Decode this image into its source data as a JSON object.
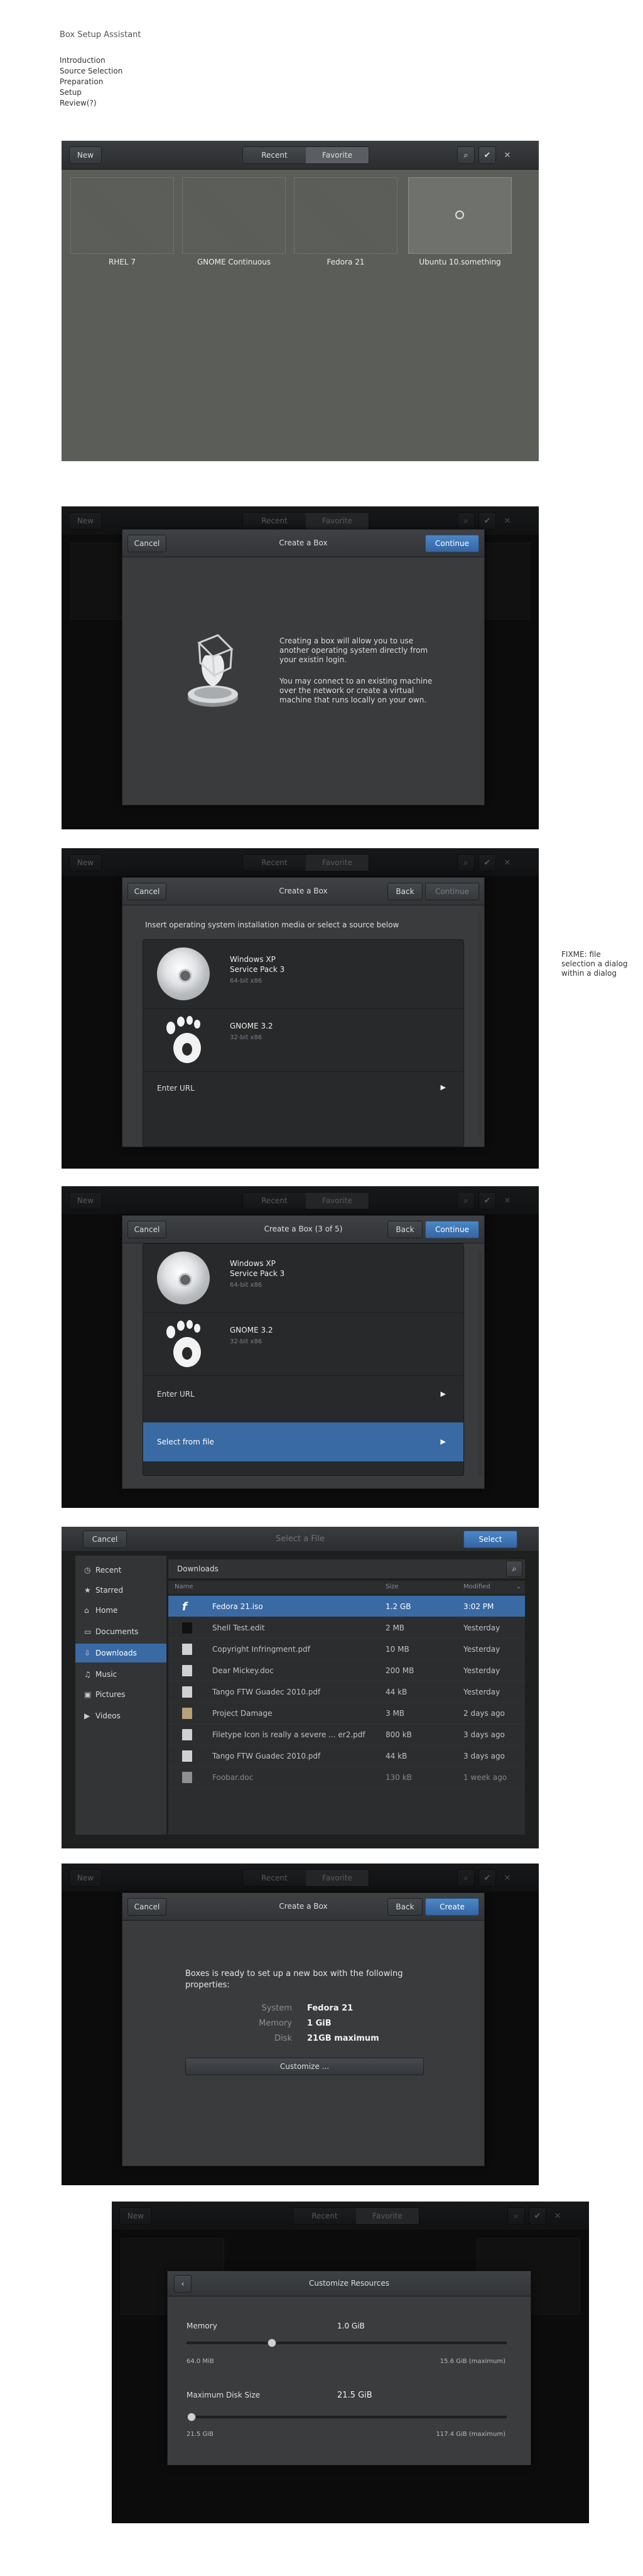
{
  "page": {
    "title": "Box Setup Assistant",
    "steps": [
      "Introduction",
      "Source Selection",
      "Preparation",
      "Setup",
      "Review(?)"
    ],
    "fixme_note": "FIXME: file selection a dialog within a dialog"
  },
  "header": {
    "new_label": "New",
    "tab_recent": "Recent",
    "tab_favorite": "Favorite",
    "search_icon": "search-icon",
    "check_icon": "check-icon",
    "close_icon": "close-icon"
  },
  "collection": {
    "boxes": [
      {
        "label": "RHEL 7"
      },
      {
        "label": "GNOME Continuous"
      },
      {
        "label": "Fedora 21"
      },
      {
        "label": "Ubuntu 10.something"
      }
    ]
  },
  "intro": {
    "cancel": "Cancel",
    "title": "Create a Box",
    "continue": "Continue",
    "p1": "Creating a box will allow you to use another operating system directly from your existin login.",
    "p2": "You may connect to an existing machine over the network or create a virtual machine that runs locally on your own."
  },
  "source": {
    "cancel": "Cancel",
    "title": "Create a Box",
    "back": "Back",
    "continue": "Continue",
    "prompt": "Insert operating system installation media or select a source below",
    "items": [
      {
        "name": "Windows XP",
        "sub": "Service Pack 3",
        "arch": "64-bit x86"
      },
      {
        "name": "GNOME 3.2",
        "sub": "",
        "arch": "32-bit x86"
      }
    ],
    "enter_url": "Enter URL",
    "select_file": "Select from file"
  },
  "source2": {
    "cancel": "Cancel",
    "title": "Create a Box (3 of 5)",
    "back": "Back",
    "continue": "Continue"
  },
  "filechooser": {
    "cancel": "Cancel",
    "title": "Select a File",
    "select": "Select",
    "location": "Downloads",
    "places": [
      {
        "icon": "clock-icon",
        "label": "Recent"
      },
      {
        "icon": "star-icon",
        "label": "Starred"
      },
      {
        "icon": "home-icon",
        "label": "Home"
      },
      {
        "icon": "folder-icon",
        "label": "Documents"
      },
      {
        "icon": "download-icon",
        "label": "Downloads"
      },
      {
        "icon": "music-icon",
        "label": "Music"
      },
      {
        "icon": "picture-icon",
        "label": "Pictures"
      },
      {
        "icon": "video-icon",
        "label": "Videos"
      }
    ],
    "cols": {
      "name": "Name",
      "size": "Size",
      "modified": "Modified"
    },
    "files": [
      {
        "name": "Fedora 21.iso",
        "size": "1.2 GB",
        "modified": "3:02 PM"
      },
      {
        "name": "Shell Test.edit",
        "size": "2 MB",
        "modified": "Yesterday"
      },
      {
        "name": "Copyright Infringment.pdf",
        "size": "10 MB",
        "modified": "Yesterday"
      },
      {
        "name": "Dear Mickey.doc",
        "size": "200 MB",
        "modified": "Yesterday"
      },
      {
        "name": "Tango FTW Guadec 2010.pdf",
        "size": "44 kB",
        "modified": "Yesterday"
      },
      {
        "name": "Project Damage",
        "size": "3 MB",
        "modified": "2 days ago"
      },
      {
        "name": "Filetype Icon is really a severe ... er2.pdf",
        "size": "800 kB",
        "modified": "3 days ago"
      },
      {
        "name": "Tango FTW Guadec 2010.pdf",
        "size": "44 kB",
        "modified": "3 days ago"
      },
      {
        "name": "Foobar.doc",
        "size": "130 kB",
        "modified": "1 week ago"
      }
    ]
  },
  "review": {
    "cancel": "Cancel",
    "title": "Create a Box",
    "back": "Back",
    "create": "Create",
    "heading": "Boxes is ready to set up a new box with the following properties:",
    "props": [
      {
        "k": "System",
        "v": "Fedora 21"
      },
      {
        "k": "Memory",
        "v": "1 GiB"
      },
      {
        "k": "Disk",
        "v": "21GB maximum"
      }
    ],
    "customize": "Customize ..."
  },
  "resources": {
    "title": "Customize Resources",
    "memory_label": "Memory",
    "memory_value": "1.0 GiB",
    "memory_min": "64.0 MiB",
    "memory_max": "15.6 GiB (maximum)",
    "memory_fraction": 0.26,
    "disk_label": "Maximum Disk Size",
    "disk_value": "21.5 GiB",
    "disk_min": "21.5 GiB",
    "disk_max": "117.4 GiB (maximum)",
    "disk_fraction": 0.0
  }
}
